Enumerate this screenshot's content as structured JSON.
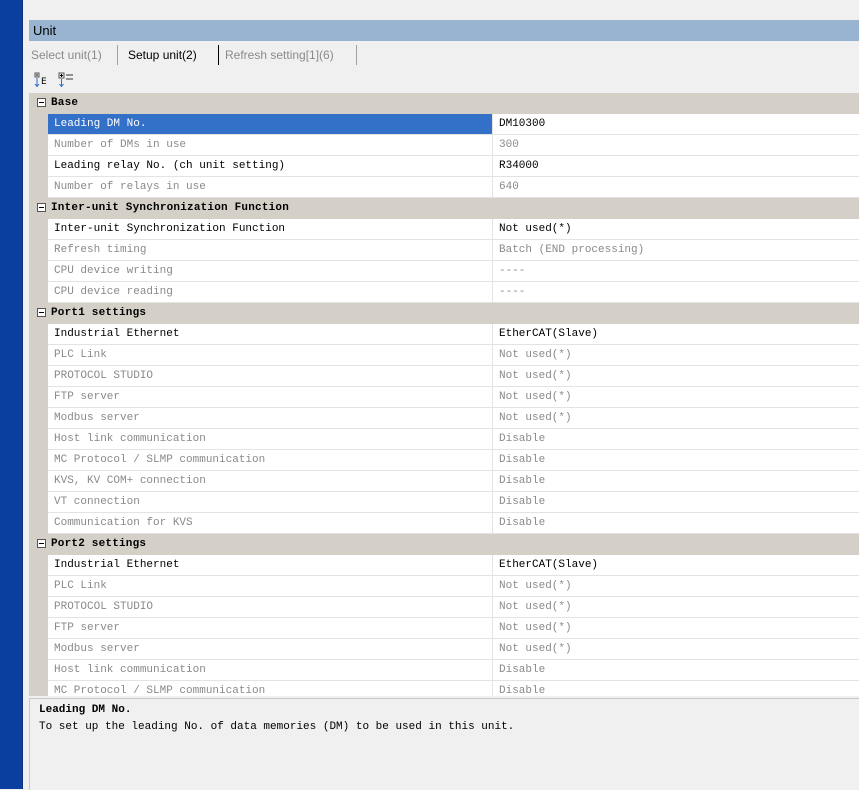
{
  "window": {
    "title": "Unit"
  },
  "tabs": [
    {
      "label": "Select unit(1)",
      "active": false
    },
    {
      "label": "Setup unit(2)",
      "active": true
    },
    {
      "label": "Refresh setting[1](6)",
      "active": false
    }
  ],
  "toolbar": [
    {
      "icon": "sort-categorized-icon"
    },
    {
      "icon": "sort-alphabetical-icon"
    }
  ],
  "sections": [
    {
      "title": "Base",
      "rows": [
        {
          "name": "Leading DM No.",
          "value": "DM10300",
          "enabled": true,
          "selected": true
        },
        {
          "name": "Number of DMs in use",
          "value": "300",
          "enabled": false
        },
        {
          "name": "Leading relay No. (ch unit setting)",
          "value": "R34000",
          "enabled": true
        },
        {
          "name": "Number of relays in use",
          "value": "640",
          "enabled": false
        }
      ]
    },
    {
      "title": "Inter-unit Synchronization Function",
      "rows": [
        {
          "name": "Inter-unit Synchronization Function",
          "value": "Not used(*)",
          "enabled": true
        },
        {
          "name": "Refresh timing",
          "value": "Batch (END processing)",
          "enabled": false
        },
        {
          "name": "CPU device writing",
          "value": "----",
          "enabled": false
        },
        {
          "name": "CPU device reading",
          "value": "----",
          "enabled": false
        }
      ]
    },
    {
      "title": "Port1 settings",
      "rows": [
        {
          "name": "Industrial Ethernet",
          "value": "EtherCAT(Slave)",
          "enabled": true
        },
        {
          "name": "PLC Link",
          "value": "Not used(*)",
          "enabled": false
        },
        {
          "name": "PROTOCOL STUDIO",
          "value": "Not used(*)",
          "enabled": false
        },
        {
          "name": "FTP server",
          "value": "Not used(*)",
          "enabled": false
        },
        {
          "name": "Modbus server",
          "value": "Not used(*)",
          "enabled": false
        },
        {
          "name": "Host link communication",
          "value": "Disable",
          "enabled": false
        },
        {
          "name": "MC Protocol / SLMP communication",
          "value": "Disable",
          "enabled": false
        },
        {
          "name": "KVS, KV COM+ connection",
          "value": "Disable",
          "enabled": false
        },
        {
          "name": "VT connection",
          "value": "Disable",
          "enabled": false
        },
        {
          "name": "Communication for KVS",
          "value": "Disable",
          "enabled": false
        }
      ]
    },
    {
      "title": "Port2 settings",
      "rows": [
        {
          "name": "Industrial Ethernet",
          "value": "EtherCAT(Slave)",
          "enabled": true
        },
        {
          "name": "PLC Link",
          "value": "Not used(*)",
          "enabled": false
        },
        {
          "name": "PROTOCOL STUDIO",
          "value": "Not used(*)",
          "enabled": false
        },
        {
          "name": "FTP server",
          "value": "Not used(*)",
          "enabled": false
        },
        {
          "name": "Modbus server",
          "value": "Not used(*)",
          "enabled": false
        },
        {
          "name": "Host link communication",
          "value": "Disable",
          "enabled": false
        },
        {
          "name": "MC Protocol / SLMP communication",
          "value": "Disable",
          "enabled": false
        }
      ]
    }
  ],
  "description": {
    "title": "Leading DM No.",
    "text": "To set up the leading No. of data memories (DM) to be used in this unit."
  },
  "colors": {
    "titlebar": "#99b4d1",
    "selection": "#3370c8",
    "category": "#d4d0c8",
    "left_bar": "#0a3fa0"
  }
}
